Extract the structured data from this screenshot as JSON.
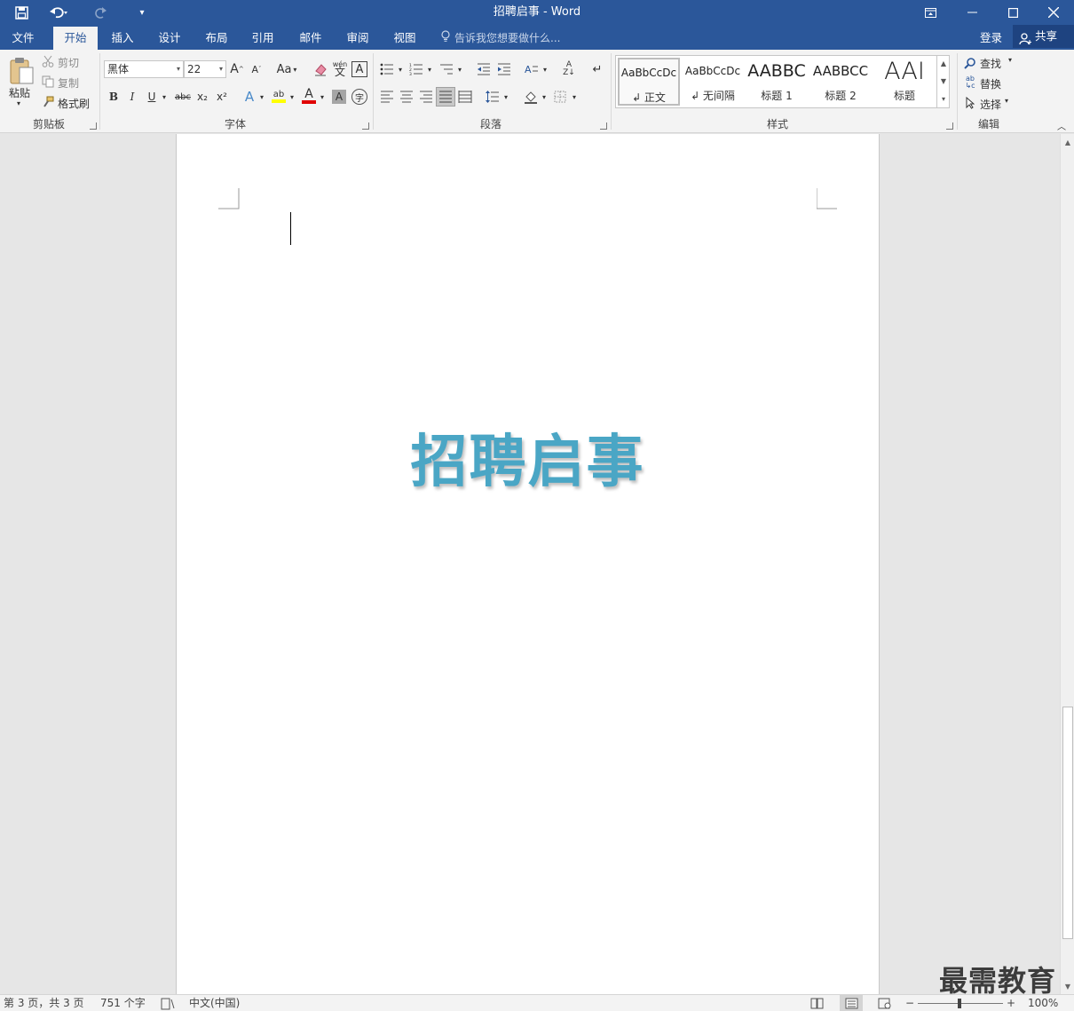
{
  "window": {
    "title": "招聘启事 - Word",
    "controls": {
      "ribbon_display": "⊡",
      "minimize": "—",
      "maximize": "☐",
      "close": "✕"
    }
  },
  "quick_access": {
    "save": "save-icon",
    "undo": "undo-icon",
    "redo": "redo-icon",
    "customize": "customize-icon"
  },
  "tabs": [
    {
      "label": "文件",
      "active": false
    },
    {
      "label": "开始",
      "active": true
    },
    {
      "label": "插入",
      "active": false
    },
    {
      "label": "设计",
      "active": false
    },
    {
      "label": "布局",
      "active": false
    },
    {
      "label": "引用",
      "active": false
    },
    {
      "label": "邮件",
      "active": false
    },
    {
      "label": "审阅",
      "active": false
    },
    {
      "label": "视图",
      "active": false
    }
  ],
  "tell_me": "告诉我您想要做什么...",
  "account": {
    "login": "登录",
    "share": "共享"
  },
  "ribbon": {
    "clipboard": {
      "label": "剪贴板",
      "paste": "粘贴",
      "cut": "剪切",
      "copy": "复制",
      "format_painter": "格式刷"
    },
    "font": {
      "label": "字体",
      "font_name": "黑体",
      "font_size": "22",
      "case_button": "Aa",
      "bold": "B",
      "italic": "I",
      "underline": "U",
      "strikethrough": "abc",
      "subscript": "x₂",
      "superscript": "x²",
      "phonetic": "wén 文",
      "char_border": "A",
      "text_effect": "A",
      "highlight": "ab",
      "font_color": "A",
      "char_shading": "A",
      "enclose": "字"
    },
    "paragraph": {
      "label": "段落"
    },
    "styles": {
      "label": "样式",
      "items": [
        {
          "sample": "AaBbCcDc",
          "name": "↲ 正文",
          "selected": true
        },
        {
          "sample": "AaBbCcDc",
          "name": "↲ 无间隔",
          "selected": false
        },
        {
          "sample": "AABBC",
          "name": "标题 1",
          "selected": false
        },
        {
          "sample": "AABBCC",
          "name": "标题 2",
          "selected": false
        },
        {
          "sample": "AAI",
          "name": "标题",
          "selected": false
        }
      ]
    },
    "editing": {
      "label": "编辑",
      "find": "查找",
      "replace": "替换",
      "select": "选择"
    }
  },
  "document": {
    "title": "招聘启事",
    "title_color": "#4aa6c5"
  },
  "status": {
    "page": "第 3 页，共 3 页",
    "words": "751 个字",
    "language": "中文(中国)",
    "zoom": "100%",
    "zoom_minus": "−",
    "zoom_plus": "+"
  },
  "watermark": "最需教育",
  "colors": {
    "accent": "#2b579a",
    "ribbon": "#f3f3f3",
    "canvas": "#e6e6e6"
  }
}
